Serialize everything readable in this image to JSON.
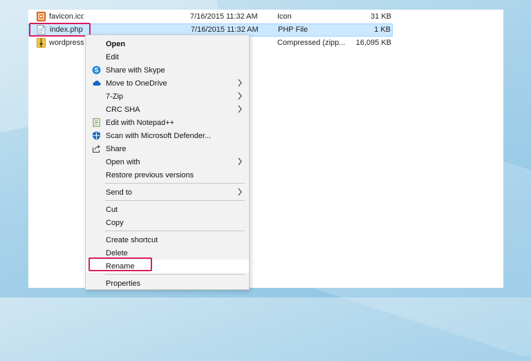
{
  "files": [
    {
      "name": "favicon.ico",
      "date": "7/16/2015 11:32 AM",
      "type": "Icon",
      "size": "31 KB",
      "icon": "ico-file-icon"
    },
    {
      "name": "index.php",
      "date": "7/16/2015 11:32 AM",
      "type": "PHP File",
      "size": "1 KB",
      "icon": "php-file-icon"
    },
    {
      "name": "wordpress-",
      "date": "",
      "type": "Compressed (zipp...",
      "size": "16,095 KB",
      "icon": "zip-file-icon"
    }
  ],
  "menu": {
    "open": "Open",
    "edit": "Edit",
    "share_skype": "Share with Skype",
    "move_onedrive": "Move to OneDrive",
    "seven_zip": "7-Zip",
    "crc_sha": "CRC SHA",
    "edit_notepad": "Edit with Notepad++",
    "scan_defender": "Scan with Microsoft Defender...",
    "share": "Share",
    "open_with": "Open with",
    "restore": "Restore previous versions",
    "send_to": "Send to",
    "cut": "Cut",
    "copy": "Copy",
    "create_shortcut": "Create shortcut",
    "delete": "Delete",
    "rename": "Rename",
    "properties": "Properties"
  },
  "colors": {
    "highlight_border": "#d81b60",
    "selection_bg": "#cce8ff",
    "menu_bg": "#f2f2f2"
  }
}
